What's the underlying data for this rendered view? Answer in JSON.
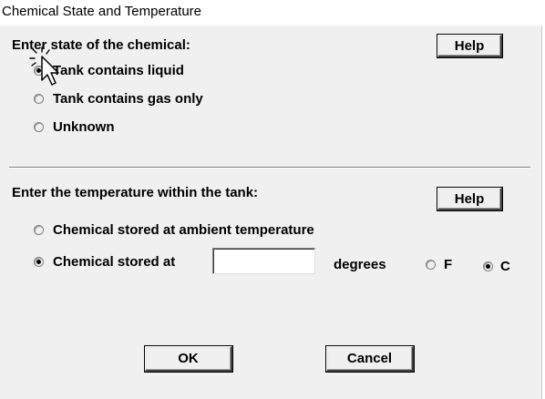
{
  "window": {
    "title": "Chemical State and Temperature"
  },
  "state_section": {
    "heading": "Enter state of the chemical:",
    "help_label": "Help",
    "options": [
      {
        "label": "Tank contains liquid",
        "checked": true
      },
      {
        "label": "Tank contains gas only",
        "checked": false
      },
      {
        "label": "Unknown",
        "checked": false
      }
    ]
  },
  "temperature_section": {
    "heading": "Enter the temperature within the tank:",
    "help_label": "Help",
    "options": [
      {
        "label": "Chemical stored at ambient temperature",
        "checked": false
      },
      {
        "label": "Chemical stored at",
        "checked": true
      }
    ],
    "temperature_value": "",
    "degrees_label": "degrees",
    "unit_f_label": "F",
    "unit_c_label": "C",
    "unit_selected": "C"
  },
  "footer": {
    "ok_label": "OK",
    "cancel_label": "Cancel"
  },
  "cursor": {
    "icon": "arrow-pointer-icon"
  }
}
